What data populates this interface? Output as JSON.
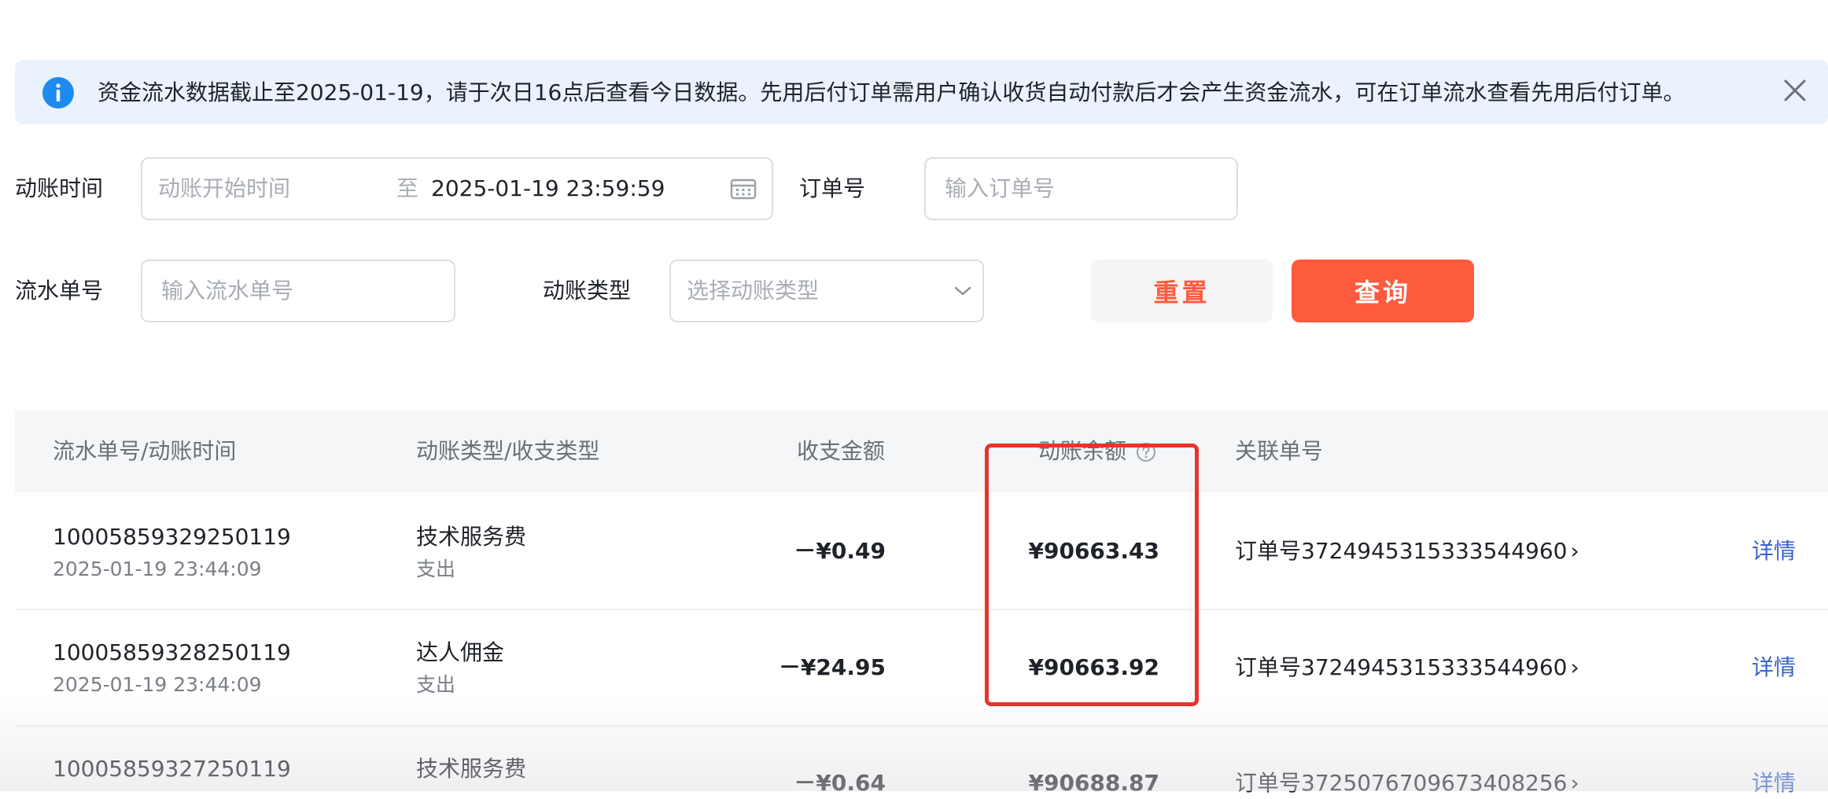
{
  "notice": {
    "text": "资金流水数据截止至2025-01-19，请于次日16点后查看今日数据。先用后付订单需用户确认收货自动付款后才会产生资金流水，可在订单流水查看先用后付订单。"
  },
  "filters": {
    "date_label": "动账时间",
    "date_start_placeholder": "动账开始时间",
    "date_separator": "至",
    "date_end_value": "2025-01-19 23:59:59",
    "order_label": "订单号",
    "order_placeholder": "输入订单号",
    "flow_label": "流水单号",
    "flow_placeholder": "输入流水单号",
    "type_label": "动账类型",
    "type_placeholder": "选择动账类型",
    "reset_label": "重置",
    "query_label": "查询"
  },
  "table": {
    "headers": {
      "flow": "流水单号/动账时间",
      "type": "动账类型/收支类型",
      "amount": "收支金额",
      "balance": "动账余额",
      "related": "关联单号"
    },
    "rows": [
      {
        "flow_no": "10005859329250119",
        "time": "2025-01-19 23:44:09",
        "type": "技术服务费",
        "direction": "支出",
        "amount": "－¥0.49",
        "balance": "¥90663.43",
        "related": "订单号3724945315333544960",
        "action": "详情"
      },
      {
        "flow_no": "10005859328250119",
        "time": "2025-01-19 23:44:09",
        "type": "达人佣金",
        "direction": "支出",
        "amount": "－¥24.95",
        "balance": "¥90663.92",
        "related": "订单号3724945315333544960",
        "action": "详情"
      },
      {
        "flow_no": "10005859327250119",
        "type": "技术服务费",
        "amount": "－¥0.64",
        "balance": "¥90688.87",
        "related": "订单号3725076709673408256",
        "action": "详情"
      }
    ]
  },
  "colors": {
    "accent": "#fe5a3e",
    "info": "#1e8bf0",
    "link": "#3a62c9",
    "highlight": "#e8342a"
  }
}
